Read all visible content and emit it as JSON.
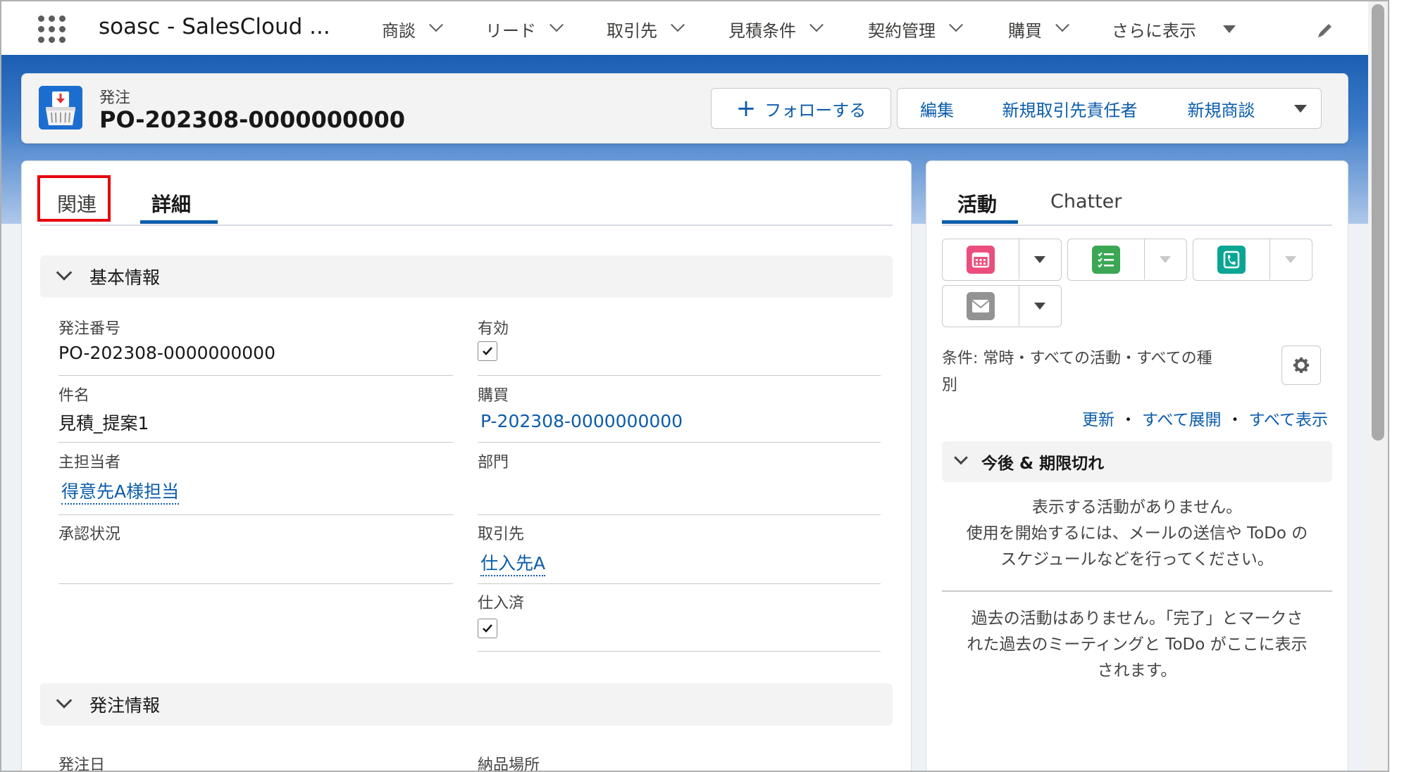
{
  "app": {
    "name": "soasc - SalesCloud ..."
  },
  "nav": {
    "items": [
      {
        "label": "商談"
      },
      {
        "label": "リード"
      },
      {
        "label": "取引先"
      },
      {
        "label": "見積条件"
      },
      {
        "label": "契約管理"
      },
      {
        "label": "購買"
      }
    ],
    "more_label": "さらに表示"
  },
  "record": {
    "type_label": "発注",
    "title": "PO-202308-0000000000",
    "actions": {
      "follow": "フォローする",
      "edit": "編集",
      "new_contact": "新規取引先責任者",
      "new_opportunity": "新規商談"
    }
  },
  "tabs": {
    "related": "関連",
    "detail": "詳細"
  },
  "sections": {
    "basic": "基本情報",
    "order": "発注情報"
  },
  "fields": {
    "po_number": {
      "label": "発注番号",
      "value": "PO-202308-0000000000"
    },
    "active": {
      "label": "有効",
      "checked": true
    },
    "subject": {
      "label": "件名",
      "value": "見積_提案1"
    },
    "purchase": {
      "label": "購買",
      "value": "P-202308-0000000000"
    },
    "owner": {
      "label": "主担当者",
      "value": "得意先A様担当"
    },
    "department": {
      "label": "部門",
      "value": ""
    },
    "approval": {
      "label": "承認状況",
      "value": ""
    },
    "account": {
      "label": "取引先",
      "value": "仕入先A"
    },
    "received": {
      "label": "仕入済",
      "checked": true
    },
    "order_date": {
      "label": "発注日"
    },
    "delivery_place": {
      "label": "納品場所"
    }
  },
  "activity": {
    "tab_activity": "活動",
    "tab_chatter": "Chatter",
    "filter_line1": "条件: 常時・すべての活動・すべての種",
    "filter_line2": "別",
    "links": {
      "refresh": "更新",
      "expand_all": "すべて展開",
      "show_all": "すべて表示",
      "dot": "・"
    },
    "upcoming_header": "今後 & 期限切れ",
    "no_activity_1": "表示する活動がありません。",
    "no_activity_2": "使用を開始するには、メールの送信や ToDo の",
    "no_activity_3": "スケジュールなどを行ってください。",
    "past_1": "過去の活動はありません。「完了」とマークさ",
    "past_2": "れた過去のミーティングと ToDo がここに表示",
    "past_3": "されます。"
  },
  "colors": {
    "brand_blue": "#0b5cab",
    "highlight_red": "#e8000b",
    "event_pink": "#eb4d7c",
    "task_green": "#3ba755",
    "call_teal": "#0aa693",
    "email_grey": "#939393"
  }
}
